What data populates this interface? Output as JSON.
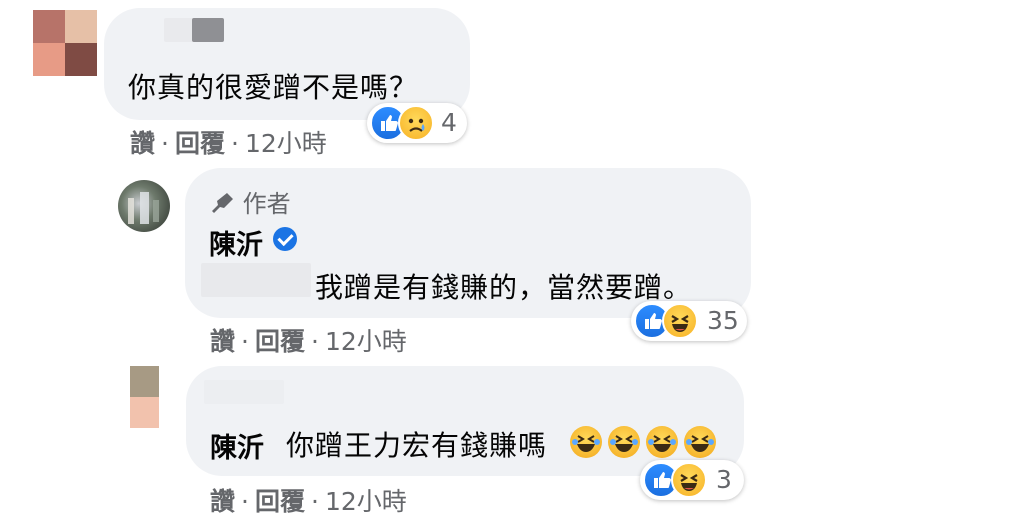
{
  "comments": [
    {
      "text": "你真的很愛蹭不是嗎？",
      "actions": {
        "like": "讚",
        "reply": "回覆",
        "sep": "·",
        "time": "12小時"
      },
      "reactions": {
        "count": "4",
        "types": [
          "like-icon",
          "sad-icon"
        ]
      }
    },
    {
      "author_badge": "作者",
      "author": "陳沂",
      "verified": true,
      "text": "我蹭是有錢賺的，當然要蹭。",
      "actions": {
        "like": "讚",
        "reply": "回覆",
        "sep": "·",
        "time": "12小時"
      },
      "reactions": {
        "count": "35",
        "types": [
          "like-icon",
          "laugh-icon"
        ]
      }
    },
    {
      "mention": "陳沂",
      "text": "你蹭王力宏有錢賺嗎",
      "trailing_emoji": [
        "rofl-emoji",
        "rofl-emoji",
        "rofl-emoji",
        "rofl-emoji"
      ],
      "actions": {
        "like": "讚",
        "reply": "回覆",
        "sep": "·",
        "time": "12小時"
      },
      "reactions": {
        "count": "3",
        "types": [
          "like-icon",
          "laugh-icon"
        ]
      }
    }
  ],
  "colors": {
    "bubble": "#f0f2f5",
    "meta_text": "#65676b",
    "like_blue": "#1b74e4"
  }
}
